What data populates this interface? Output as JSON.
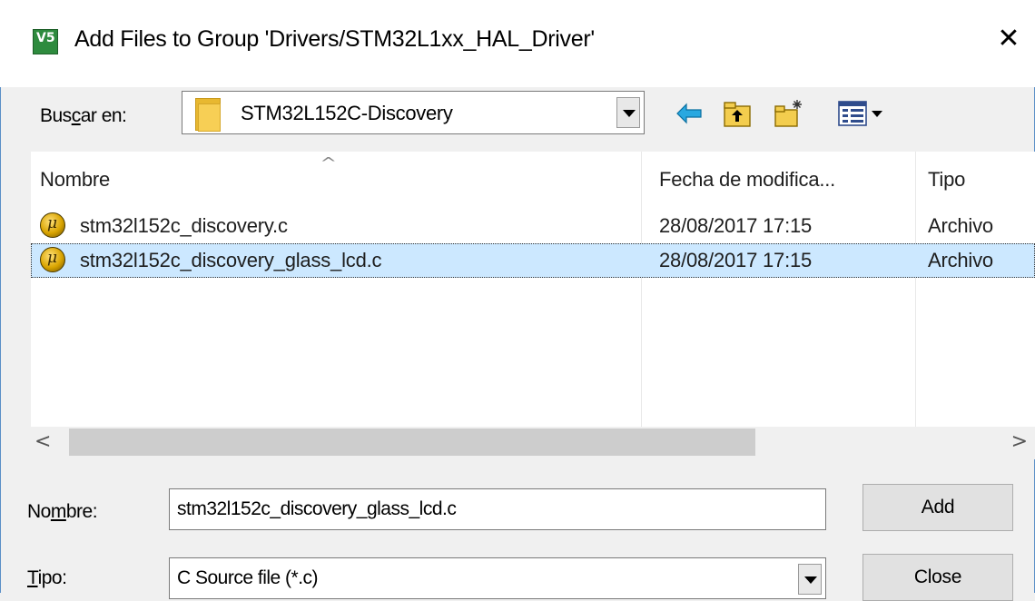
{
  "window": {
    "title": "Add Files to Group 'Drivers/STM32L1xx_HAL_Driver'",
    "app_icon_text": "V5",
    "close_glyph": "✕"
  },
  "lookin": {
    "label_pre": "Bus",
    "label_u": "c",
    "label_post": "ar en:",
    "folder": "STM32L152C-Discovery"
  },
  "columns": {
    "name": "Nombre",
    "date": "Fecha de modifica...",
    "type": "Tipo"
  },
  "files": [
    {
      "name": "stm32l152c_discovery.c",
      "date": "28/08/2017 17:15",
      "type": "Archivo",
      "selected": false
    },
    {
      "name": "stm32l152c_discovery_glass_lcd.c",
      "date": "28/08/2017 17:15",
      "type": "Archivo",
      "selected": true
    }
  ],
  "filename": {
    "label_pre": "No",
    "label_u": "m",
    "label_post": "bre:",
    "value": "stm32l152c_discovery_glass_lcd.c"
  },
  "filetype": {
    "label_u": "T",
    "label_post": "ipo:",
    "value": "C Source file (*.c)"
  },
  "buttons": {
    "add": "Add",
    "close": "Close"
  },
  "colors": {
    "selection": "#cce8ff",
    "window_border": "#5a8fc7",
    "app_icon": "#2e8b3e"
  }
}
